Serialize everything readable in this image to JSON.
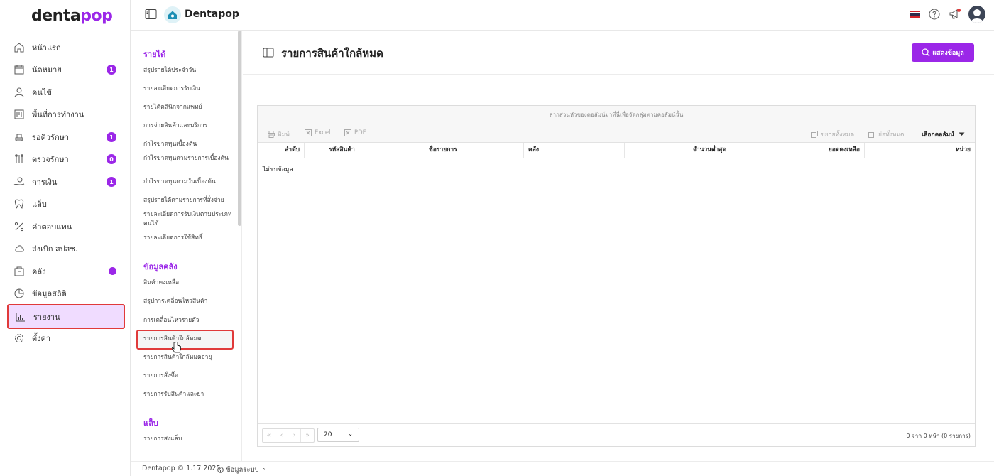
{
  "brand": {
    "logo_main": "denta",
    "logo_accent": "pop",
    "app_name": "Dentapop"
  },
  "nav": {
    "items": [
      {
        "label": "หน้าแรก",
        "icon": "home-icon"
      },
      {
        "label": "นัดหมาย",
        "icon": "calendar-icon",
        "badge": "1"
      },
      {
        "label": "คนไข้",
        "icon": "user-icon"
      },
      {
        "label": "พื้นที่การทำงาน",
        "icon": "board-icon"
      },
      {
        "label": "รอคิวรักษา",
        "icon": "chair-icon",
        "badge": "1"
      },
      {
        "label": "ตรวจรักษา",
        "icon": "tools-icon",
        "badge": "0"
      },
      {
        "label": "การเงิน",
        "icon": "money-icon",
        "badge": "1"
      },
      {
        "label": "แล็บ",
        "icon": "tooth-icon"
      },
      {
        "label": "ค่าตอบแทน",
        "icon": "percent-icon"
      },
      {
        "label": "ส่งเบิก สปสช.",
        "icon": "cloud-icon"
      },
      {
        "label": "คลัง",
        "icon": "box-icon"
      },
      {
        "label": "ข้อมูลสถิติ",
        "icon": "chart-circle-icon"
      },
      {
        "label": "รายงาน",
        "icon": "report-icon"
      },
      {
        "label": "ตั้งค่า",
        "icon": "gear-icon"
      }
    ]
  },
  "submenu": {
    "sections": [
      {
        "title": "รายได้",
        "items": [
          "สรุปรายได้ประจำวัน",
          "รายละเอียดการรับเงิน",
          "รายได้คลินิกจากแพทย์",
          "การจ่ายสินค้าและบริการ",
          "กำไรขาดทุนเบื้องต้น",
          "กำไรขาดทุนตามรายการเบื้องต้น",
          "กำไรขาดทุนตามวันเบื้องต้น",
          "สรุปรายได้ตามรายการที่สั่งจ่าย",
          "รายละเอียดการรับเงินตามประเภทคนไข้",
          "รายละเอียดการใช้สิทธิ์"
        ]
      },
      {
        "title": "ข้อมูลคลัง",
        "items": [
          "สินค้าคงเหลือ",
          "สรุปการเคลื่อนไหวสินค้า",
          "การเคลื่อนไหวรายตัว",
          "รายการสินค้าใกล้หมด",
          "รายการสินค้าใกล้หมดอายุ",
          "รายการสั่งซื้อ",
          "รายการรับสินค้าและยา"
        ]
      },
      {
        "title": "แล็บ",
        "items": [
          "รายการส่งแล็บ"
        ]
      }
    ]
  },
  "page": {
    "title": "รายการสินค้าใกล้หมด",
    "show_button": "แสดงข้อมูล"
  },
  "grid": {
    "group_hint": "ลากส่วนหัวของคอลัมน์มาที่นี่เพื่อจัดกลุ่มตามคอลัมน์นั้น",
    "toolbar": {
      "print": "พิมพ์",
      "excel": "Excel",
      "pdf": "PDF",
      "expand_all": "ขยายทั้งหมด",
      "collapse_all": "ย่อทั้งหมด",
      "choose_columns": "เลือกคอลัมน์"
    },
    "columns": [
      "ลำดับ",
      "รหัสสินค้า",
      "ชื่อรายการ",
      "คลัง",
      "จำนวนต่ำสุด",
      "ยอดคงเหลือ",
      "หน่วย"
    ],
    "empty_text": "ไม่พบข้อมูล",
    "pager": {
      "first": "«",
      "prev": "‹",
      "next": "›",
      "last": "»",
      "page_size": "20",
      "info": "0 จาก 0 หน้า (0 รายการ)"
    }
  },
  "footer": {
    "copyright": "Dentapop © 1.17 2025",
    "system_info": "ข้อมูลระบบ"
  },
  "colors": {
    "accent": "#9b27e8",
    "highlight_border": "#e03a3a",
    "active_bg": "#f0dcff"
  }
}
